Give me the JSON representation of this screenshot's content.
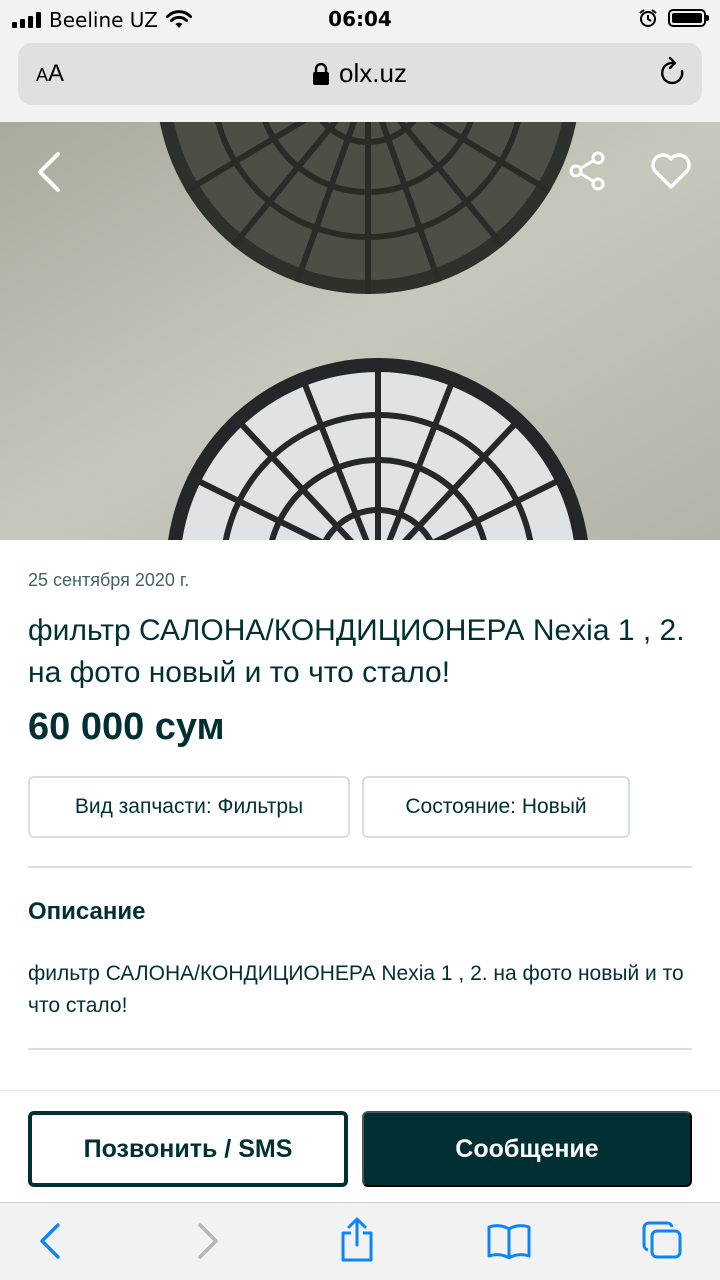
{
  "status_bar": {
    "carrier": "Beeline UZ",
    "time": "06:04"
  },
  "browser": {
    "text_size_label_small": "A",
    "text_size_label_large": "A",
    "domain": "olx.uz"
  },
  "listing": {
    "date": "25 сентября 2020 г.",
    "title": "фильтр САЛОНА/КОНДИЦИОНЕРА Nexia 1 , 2. на фото новый и то что стало!",
    "price": "60 000 сум",
    "params": [
      {
        "label": "Вид запчасти: Фильтры"
      },
      {
        "label": "Состояние: Новый"
      }
    ],
    "description_heading": "Описание",
    "description": "фильтр САЛОНА/КОНДИЦИОНЕРА Nexia 1 , 2. на фото новый и то что стало!"
  },
  "actions": {
    "call_label": "Позвонить / SMS",
    "message_label": "Сообщение"
  },
  "icons": {
    "back": "chevron-left-icon",
    "share": "share-icon",
    "favorite": "heart-icon",
    "lock": "lock-icon",
    "reload": "reload-icon",
    "toolbar": [
      "back-arrow-icon",
      "forward-arrow-icon",
      "share-up-icon",
      "bookmarks-icon",
      "tabs-icon"
    ]
  },
  "colors": {
    "brand_dark": "#002f34",
    "safari_blue": "#0a84ff",
    "muted_text": "#406367",
    "border": "#d8dfe0"
  }
}
